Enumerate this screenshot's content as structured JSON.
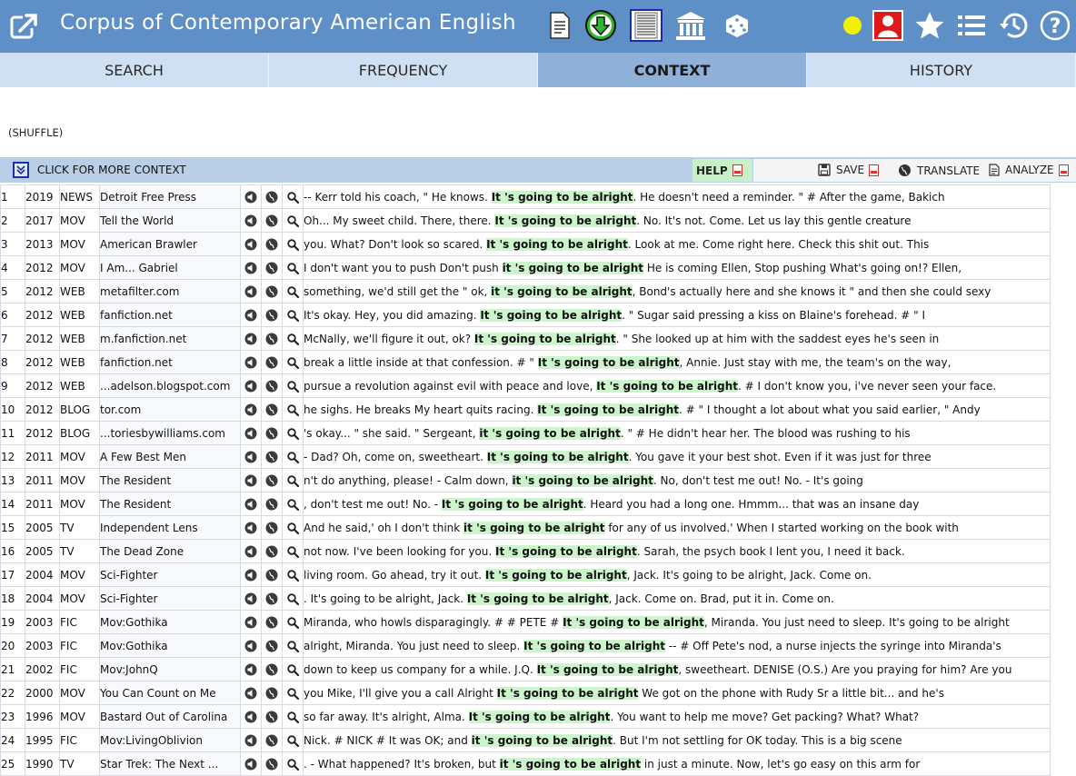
{
  "app": {
    "title": "Corpus of Contemporary American English"
  },
  "toolbar_icons": [
    "external-link-icon",
    "document-icon",
    "download-icon",
    "text-page-icon",
    "museum-icon",
    "dice-icon",
    "yellow-dot-icon",
    "user-icon",
    "star-icon",
    "list-icon",
    "history-icon",
    "help-icon"
  ],
  "tabs": [
    {
      "label": "SEARCH",
      "active": false
    },
    {
      "label": "FREQUENCY",
      "active": false
    },
    {
      "label": "CONTEXT",
      "active": true
    },
    {
      "label": "HISTORY",
      "active": false
    }
  ],
  "shuffle_label": "(SHUFFLE)",
  "context_bar": {
    "more_context_label": "CLICK FOR MORE CONTEXT",
    "help_label": "HELP",
    "save_label": "SAVE",
    "translate_label": "TRANSLATE",
    "analyze_label": "ANALYZE"
  },
  "rows": [
    {
      "n": "1",
      "year": "2019",
      "genre": "NEWS",
      "source": "Detroit Free Press",
      "pre": "-- Kerr told his coach, \" He knows. ",
      "hit": "It 's going to be alright",
      "post": ". He doesn't need a reminder. \" # After the game, Bakich"
    },
    {
      "n": "2",
      "year": "2017",
      "genre": "MOV",
      "source": "Tell the World",
      "pre": "Oh... My sweet child. There, there. ",
      "hit": "It 's going to be alright",
      "post": ". No. It's not. Come. Let us lay this gentle creature"
    },
    {
      "n": "3",
      "year": "2013",
      "genre": "MOV",
      "source": "American Brawler",
      "pre": "you. What? Don't look so scared. ",
      "hit": "It 's going to be alright",
      "post": ". Look at me. Come right here. Check this shit out. This"
    },
    {
      "n": "4",
      "year": "2012",
      "genre": "MOV",
      "source": "I Am... Gabriel",
      "pre": "I don't want you to push Don't push ",
      "hit": "it 's going to be alright",
      "post": " He is coming Ellen, Stop pushing What's going on!? Ellen,"
    },
    {
      "n": "5",
      "year": "2012",
      "genre": "WEB",
      "source": "metafilter.com",
      "pre": "something, we'd still get the \" ok, ",
      "hit": "it 's going to be alright",
      "post": ", Bond's actually here and she knows it \" and then she could sexy"
    },
    {
      "n": "6",
      "year": "2012",
      "genre": "WEB",
      "source": "fanfiction.net",
      "pre": "It's okay. Hey, you did amazing. ",
      "hit": "It 's going to be alright",
      "post": ". \" Sugar said pressing a kiss on Blaine's forehead. # \" I"
    },
    {
      "n": "7",
      "year": "2012",
      "genre": "WEB",
      "source": "m.fanfiction.net",
      "pre": "McNally, we'll figure it out, ok? ",
      "hit": "It 's going to be alright",
      "post": ". \" She looked up at him with the saddest eyes he's seen in"
    },
    {
      "n": "8",
      "year": "2012",
      "genre": "WEB",
      "source": "fanfiction.net",
      "pre": "break a little inside at that confession. # \" ",
      "hit": "It 's going to be alright",
      "post": ", Annie. Just stay with me, the team's on the way,"
    },
    {
      "n": "9",
      "year": "2012",
      "genre": "WEB",
      "source": "...adelson.blogspot.com",
      "pre": "pursue a revolution against evil with peace and love, ",
      "hit": "It 's going to be alright",
      "post": ". # I don't know you, i've never seen your face."
    },
    {
      "n": "10",
      "year": "2012",
      "genre": "BLOG",
      "source": "tor.com",
      "pre": "he sighs. He breaks My heart quits racing. ",
      "hit": "It 's going to be alright",
      "post": ". # \" I thought a lot about what you said earlier, \" Andy"
    },
    {
      "n": "11",
      "year": "2012",
      "genre": "BLOG",
      "source": "...toriesbywilliams.com",
      "pre": "'s okay... \" she said. \" Sergeant, ",
      "hit": "it 's going to be alright",
      "post": ". \" # He didn't hear her. The blood was rushing to his"
    },
    {
      "n": "12",
      "year": "2011",
      "genre": "MOV",
      "source": "A Few Best Men",
      "pre": "- Dad? Oh, come on, sweetheart. ",
      "hit": "It 's going to be alright",
      "post": ". You gave it your best shot. Even if it was just for three"
    },
    {
      "n": "13",
      "year": "2011",
      "genre": "MOV",
      "source": "The Resident",
      "pre": "n't do anything, please! - Calm down, ",
      "hit": "it 's going to be alright",
      "post": ". No, don't test me out! No. - It's going"
    },
    {
      "n": "14",
      "year": "2011",
      "genre": "MOV",
      "source": "The Resident",
      "pre": ", don't test me out! No. - ",
      "hit": "It 's going to be alright",
      "post": ". Heard you had a long one. Hmmm... that was an insane day"
    },
    {
      "n": "15",
      "year": "2005",
      "genre": "TV",
      "source": "Independent Lens",
      "pre": "And he said,' oh I don't think ",
      "hit": "it 's going to be alright",
      "post": " for any of us involved.' When I started working on the book with"
    },
    {
      "n": "16",
      "year": "2005",
      "genre": "TV",
      "source": "The Dead Zone",
      "pre": "not now. I've been looking for you. ",
      "hit": "It 's going to be alright",
      "post": ". Sarah, the psych book I lent you, I need it back."
    },
    {
      "n": "17",
      "year": "2004",
      "genre": "MOV",
      "source": "Sci-Fighter",
      "pre": "living room. Go ahead, try it out. ",
      "hit": "It 's going to be alright",
      "post": ", Jack. It's going to be alright, Jack. Come on."
    },
    {
      "n": "18",
      "year": "2004",
      "genre": "MOV",
      "source": "Sci-Fighter",
      "pre": ". It's going to be alright, Jack. ",
      "hit": "It 's going to be alright",
      "post": ", Jack. Come on. Brad, put it in. Come on."
    },
    {
      "n": "19",
      "year": "2003",
      "genre": "FIC",
      "source": "Mov:Gothika",
      "pre": "Miranda, who howls disparagingly. # # PETE # ",
      "hit": "It 's going to be alright",
      "post": ", Miranda. You just need to sleep. It's going to be alright"
    },
    {
      "n": "20",
      "year": "2003",
      "genre": "FIC",
      "source": "Mov:Gothika",
      "pre": "alright, Miranda. You just need to sleep. ",
      "hit": "It 's going to be alright",
      "post": " -- # Off Pete's nod, a nurse injects the syringe into Miranda's"
    },
    {
      "n": "21",
      "year": "2002",
      "genre": "FIC",
      "source": "Mov:JohnQ",
      "pre": "down to keep us company for a while. J.Q. ",
      "hit": "It 's going to be alright",
      "post": ", sweetheart. DENISE (O.S.) Are you praying for him? Are you"
    },
    {
      "n": "22",
      "year": "2000",
      "genre": "MOV",
      "source": "You Can Count on Me",
      "pre": "you Mike, I'll give you a call Alright ",
      "hit": "It 's going to be alright",
      "post": " We got on the phone with Rudy Sr a little bit... and he's"
    },
    {
      "n": "23",
      "year": "1996",
      "genre": "MOV",
      "source": "Bastard Out of Carolina",
      "pre": "so far away. It's alright, Alma. ",
      "hit": "It 's going to be alright",
      "post": ". You want to help me move? Get packing? What? What?"
    },
    {
      "n": "24",
      "year": "1995",
      "genre": "FIC",
      "source": "Mov:LivingOblivion",
      "pre": "Nick. # NICK # It was OK; and ",
      "hit": "it 's going to be alright",
      "post": ". But I'm not settling for OK today. This is a big scene"
    },
    {
      "n": "25",
      "year": "1990",
      "genre": "TV",
      "source": "Star Trek: The Next ...",
      "pre": ". - What happened? It's broken, but ",
      "hit": "it 's going to be alright",
      "post": " in just a minute. Now, let's go easy on this arm for"
    }
  ]
}
